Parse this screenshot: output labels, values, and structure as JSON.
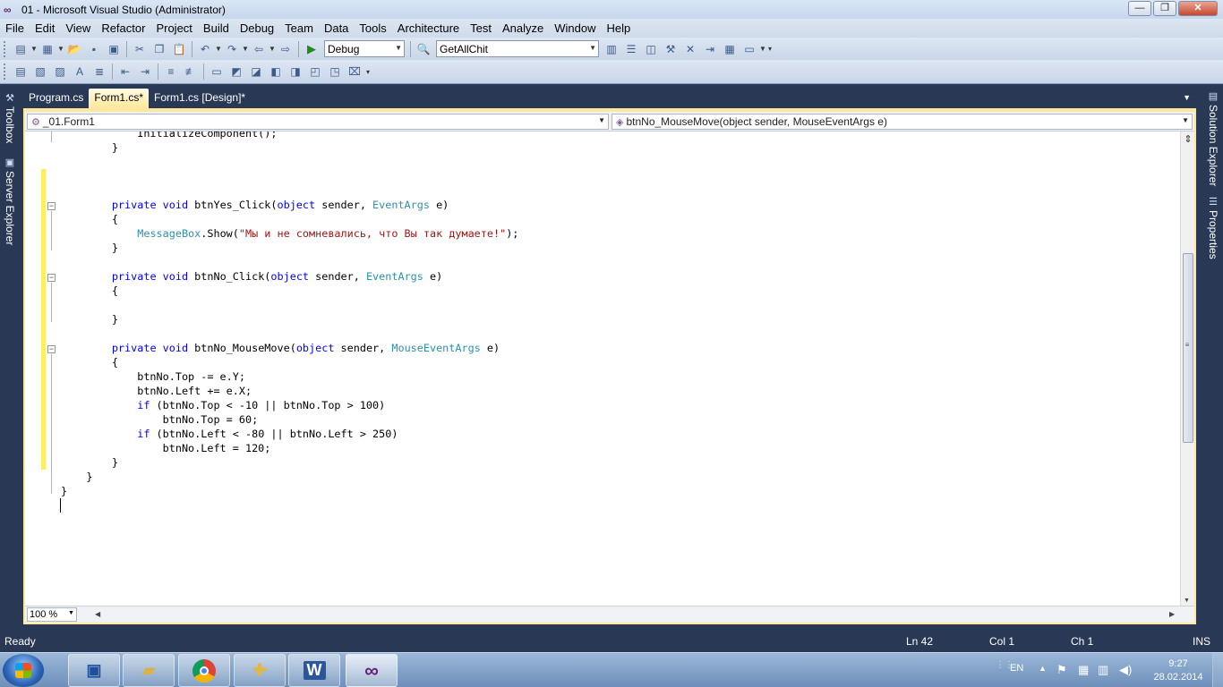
{
  "window": {
    "title": "01 - Microsoft Visual Studio (Administrator)",
    "buttons": {
      "minimize": "—",
      "maximize": "❐",
      "close": "✕"
    }
  },
  "menu": [
    "File",
    "Edit",
    "View",
    "Refactor",
    "Project",
    "Build",
    "Debug",
    "Team",
    "Data",
    "Tools",
    "Architecture",
    "Test",
    "Analyze",
    "Window",
    "Help"
  ],
  "toolbar": {
    "config": "Debug",
    "find": "GetAllChit"
  },
  "side_tabs": {
    "left": [
      "Toolbox",
      "Server Explorer"
    ],
    "right": [
      "Solution Explorer",
      "Properties"
    ]
  },
  "tabs": [
    {
      "label": "Program.cs",
      "active": false
    },
    {
      "label": "Form1.cs*",
      "active": true
    },
    {
      "label": "Form1.cs [Design]*",
      "active": false
    }
  ],
  "nav": {
    "class": "_01.Form1",
    "member": "btnNo_MouseMove(object sender, MouseEventArgs e)"
  },
  "code": [
    [
      [
        "p",
        "            InitializeComponent();"
      ]
    ],
    [
      [
        "p",
        "        }"
      ]
    ],
    [
      [
        "p",
        ""
      ]
    ],
    [
      [
        "p",
        ""
      ]
    ],
    [
      [
        "p",
        ""
      ]
    ],
    [
      [
        "p",
        "        "
      ],
      [
        "k",
        "private void"
      ],
      [
        "p",
        " btnYes_Click("
      ],
      [
        "k",
        "object"
      ],
      [
        "p",
        " sender, "
      ],
      [
        "t",
        "EventArgs"
      ],
      [
        "p",
        " e)"
      ]
    ],
    [
      [
        "p",
        "        {"
      ]
    ],
    [
      [
        "p",
        "            "
      ],
      [
        "t",
        "MessageBox"
      ],
      [
        "p",
        ".Show("
      ],
      [
        "s",
        "\"Мы и не сомневались, что Вы так думаете!\""
      ],
      [
        "p",
        ");"
      ]
    ],
    [
      [
        "p",
        "        }"
      ]
    ],
    [
      [
        "p",
        ""
      ]
    ],
    [
      [
        "p",
        "        "
      ],
      [
        "k",
        "private void"
      ],
      [
        "p",
        " btnNo_Click("
      ],
      [
        "k",
        "object"
      ],
      [
        "p",
        " sender, "
      ],
      [
        "t",
        "EventArgs"
      ],
      [
        "p",
        " e)"
      ]
    ],
    [
      [
        "p",
        "        {"
      ]
    ],
    [
      [
        "p",
        ""
      ]
    ],
    [
      [
        "p",
        "        }"
      ]
    ],
    [
      [
        "p",
        ""
      ]
    ],
    [
      [
        "p",
        "        "
      ],
      [
        "k",
        "private void"
      ],
      [
        "p",
        " btnNo_MouseMove("
      ],
      [
        "k",
        "object"
      ],
      [
        "p",
        " sender, "
      ],
      [
        "t",
        "MouseEventArgs"
      ],
      [
        "p",
        " e)"
      ]
    ],
    [
      [
        "p",
        "        {"
      ]
    ],
    [
      [
        "p",
        "            btnNo.Top -= e.Y;"
      ]
    ],
    [
      [
        "p",
        "            btnNo.Left += e.X;"
      ]
    ],
    [
      [
        "p",
        "            "
      ],
      [
        "k",
        "if"
      ],
      [
        "p",
        " (btnNo.Top < -10 || btnNo.Top > 100)"
      ]
    ],
    [
      [
        "p",
        "                btnNo.Top = 60;"
      ]
    ],
    [
      [
        "p",
        "            "
      ],
      [
        "k",
        "if"
      ],
      [
        "p",
        " (btnNo.Left < -80 || btnNo.Left > 250)"
      ]
    ],
    [
      [
        "p",
        "                btnNo.Left = 120;"
      ]
    ],
    [
      [
        "p",
        "        }"
      ]
    ],
    [
      [
        "p",
        "    }"
      ]
    ],
    [
      [
        "p",
        "}"
      ]
    ]
  ],
  "zoom": "100 %",
  "status": {
    "message": "Ready",
    "line": "Ln 42",
    "col": "Col 1",
    "ch": "Ch 1",
    "mode": "INS"
  },
  "taskbar": {
    "apps": [
      "save-icon",
      "folder-icon",
      "chrome-icon",
      "app-icon",
      "word-icon",
      "visual-studio-icon"
    ],
    "tray": {
      "lang": "EN",
      "time": "9:27",
      "date": "28.02.2014"
    }
  },
  "colors": {
    "keyword": "#0000ff",
    "type": "#2b91af",
    "string": "#a31515",
    "active_tab": "#ffe89b",
    "chrome": "#293955"
  }
}
